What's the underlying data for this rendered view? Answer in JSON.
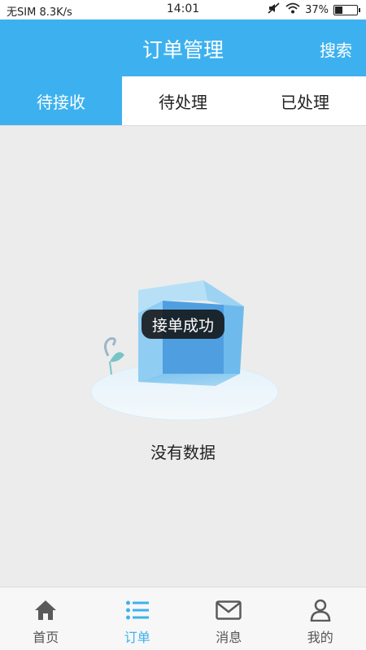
{
  "status_bar": {
    "carrier": "无SIM",
    "speed": "8.3K/s",
    "time": "14:01",
    "battery_percent": "37%",
    "battery_level": 0.37
  },
  "header": {
    "title": "订单管理",
    "search_label": "搜索"
  },
  "tabs": [
    {
      "label": "待接收",
      "active": true
    },
    {
      "label": "待处理",
      "active": false
    },
    {
      "label": "已处理",
      "active": false
    }
  ],
  "empty_state": {
    "text": "没有数据"
  },
  "toast": {
    "text": "接单成功"
  },
  "bottom_nav": [
    {
      "label": "首页",
      "icon": "home-icon",
      "active": false
    },
    {
      "label": "订单",
      "icon": "list-icon",
      "active": true
    },
    {
      "label": "消息",
      "icon": "mail-icon",
      "active": false
    },
    {
      "label": "我的",
      "icon": "user-icon",
      "active": false
    }
  ],
  "colors": {
    "accent": "#3db1ef",
    "background": "#ececec",
    "toast_bg": "#141414"
  }
}
